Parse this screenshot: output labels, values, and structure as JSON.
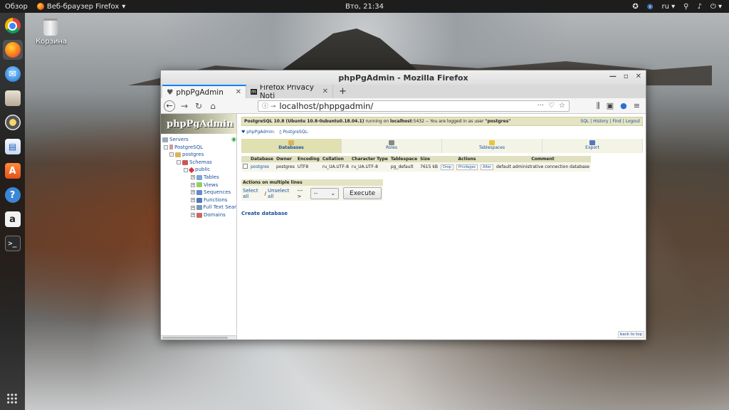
{
  "topbar": {
    "overview": "Обзор",
    "app_name": "Веб-браузер Firefox",
    "clock": "Вто, 21:34",
    "lang": "ru"
  },
  "desktop": {
    "trash_label": "Корзина"
  },
  "dock": {
    "items": [
      "chrome-icon",
      "firefox-icon",
      "thunderbird-icon",
      "files-icon",
      "rhythmbox-icon",
      "writer-icon",
      "software-icon",
      "help-icon",
      "amazon-icon",
      "terminal-icon"
    ]
  },
  "window": {
    "title": "phpPgAdmin - Mozilla Firefox",
    "tabs": [
      {
        "label": "phpPgAdmin"
      },
      {
        "label": "Firefox Privacy Noti"
      }
    ],
    "url": "localhost/phppgadmin/",
    "url_dots": "···"
  },
  "sidebar": {
    "logo": "phpPgAdmin",
    "tree": [
      {
        "label": "Servers"
      },
      {
        "label": "PostgreSQL"
      },
      {
        "label": "postgres"
      },
      {
        "label": "Schemas"
      },
      {
        "label": "public"
      },
      {
        "label": "Tables"
      },
      {
        "label": "Views"
      },
      {
        "label": "Sequences"
      },
      {
        "label": "Functions"
      },
      {
        "label": "Full Text Sear"
      },
      {
        "label": "Domains"
      }
    ]
  },
  "main": {
    "info_server": "PostgreSQL 10.8 (Ubuntu 10.8-0ubuntu0.18.04.1)",
    "info_running": "running on",
    "info_host": "localhost",
    "info_rest": ":5432 -- You are logged in as user",
    "info_user": "\"postgres\"",
    "links": [
      "SQL",
      "History",
      "Find",
      "Logout"
    ],
    "trail": [
      "phpPgAdmin:",
      "PostgreSQL:"
    ],
    "tabs": [
      "Databases",
      "Roles",
      "Tablespaces",
      "Export"
    ],
    "table": {
      "headers": [
        "Database",
        "Owner",
        "Encoding",
        "Collation",
        "Character Type",
        "Tablespace",
        "Size",
        "Actions",
        "Comment"
      ],
      "rows": [
        {
          "database": "postgres",
          "owner": "postgres",
          "encoding": "UTF8",
          "collation": "ru_UA.UTF-8",
          "ctype": "ru_UA.UTF-8",
          "tablespace": "pg_default",
          "size": "7615 kB",
          "actions": [
            "Drop",
            "Privileges",
            "Alter"
          ],
          "comment": "default administrative connection database"
        }
      ]
    },
    "multi": {
      "header": "Actions on multiple lines",
      "select_all": "Select all",
      "separator": "/",
      "unselect_all": "Unselect all",
      "arrow": "--->",
      "select_value": "--",
      "execute": "Execute"
    },
    "create_db": "Create database",
    "back_to_top": "back to top"
  }
}
